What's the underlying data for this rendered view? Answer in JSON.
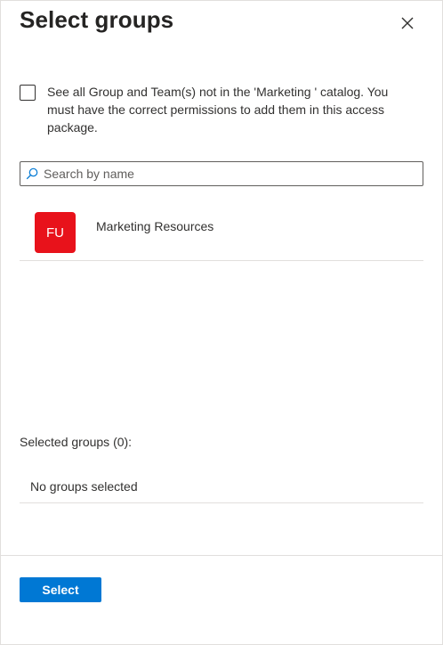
{
  "panel": {
    "title": "Select groups",
    "close_icon": "close-icon"
  },
  "catalog_option": {
    "checked": false,
    "label": "See all Group and Team(s) not in the 'Marketing ' catalog. You must have the correct permissions to add them in this access package."
  },
  "search": {
    "placeholder": "Search by name",
    "value": "",
    "icon": "search-icon"
  },
  "groups": [
    {
      "initials": "FU",
      "name": "Marketing Resources",
      "avatar_color": "#e8121b"
    }
  ],
  "selected": {
    "label": "Selected groups (0):",
    "empty_text": "No groups selected"
  },
  "footer": {
    "select_label": "Select"
  },
  "colors": {
    "accent": "#0078d4",
    "avatar": "#e8121b",
    "divider": "#e1dfdd",
    "text": "#323130"
  }
}
